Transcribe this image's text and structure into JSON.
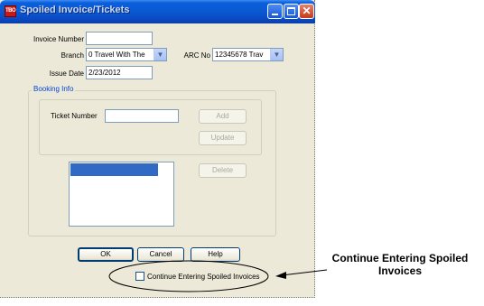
{
  "window": {
    "title": "Spoiled Invoice/Tickets",
    "app_icon_text": "TBO",
    "minimize_icon": "minimize-icon",
    "maximize_icon": "maximize-icon",
    "close_symbol": "✕"
  },
  "form": {
    "invoice_number_label": "Invoice Number",
    "invoice_number_value": "",
    "branch_label": "Branch",
    "branch_value": "0  Travel With The",
    "arc_no_label": "ARC No",
    "arc_no_value": "12345678 Trav",
    "issue_date_label": "Issue Date",
    "issue_date_value": "2/23/2012",
    "dropdown_arrow": "▼"
  },
  "booking": {
    "group_label": "Booking Info",
    "ticket_number_label": "Ticket Number",
    "ticket_number_value": "",
    "add_label": "Add",
    "update_label": "Update",
    "delete_label": "Delete"
  },
  "buttons": {
    "ok": "OK",
    "cancel": "Cancel",
    "help": "Help"
  },
  "continue_checkbox": {
    "label": "Continue Entering Spoiled Invoices",
    "checked": false
  },
  "callout": {
    "line1": "Continue Entering Spoiled",
    "line2": "Invoices"
  },
  "colors": {
    "titlebar": "#0a58d2",
    "dialog_background": "#ece9d8",
    "group_label": "#0046d5",
    "list_selection": "#316ac5"
  }
}
